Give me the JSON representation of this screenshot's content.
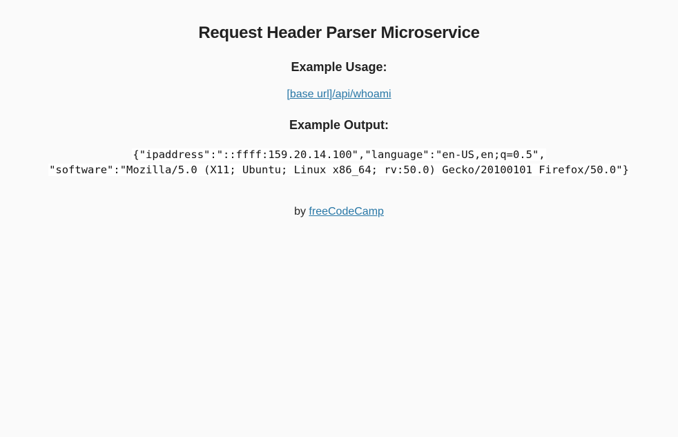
{
  "page": {
    "title": "Request Header Parser Microservice",
    "usage_heading": "Example Usage:",
    "usage_link": "[base url]/api/whoami",
    "output_heading": "Example Output:",
    "output_line1": "{\"ipaddress\":\"::ffff:159.20.14.100\",\"language\":\"en-US,en;q=0.5\",",
    "output_line2": "\"software\":\"Mozilla/5.0 (X11; Ubuntu; Linux x86_64; rv:50.0) Gecko/20100101 Firefox/50.0\"}",
    "credit_prefix": "by",
    "credit_link": "freeCodeCamp"
  },
  "colors": {
    "background": "#fafafa",
    "link": "#2877a6",
    "text": "#222222"
  }
}
